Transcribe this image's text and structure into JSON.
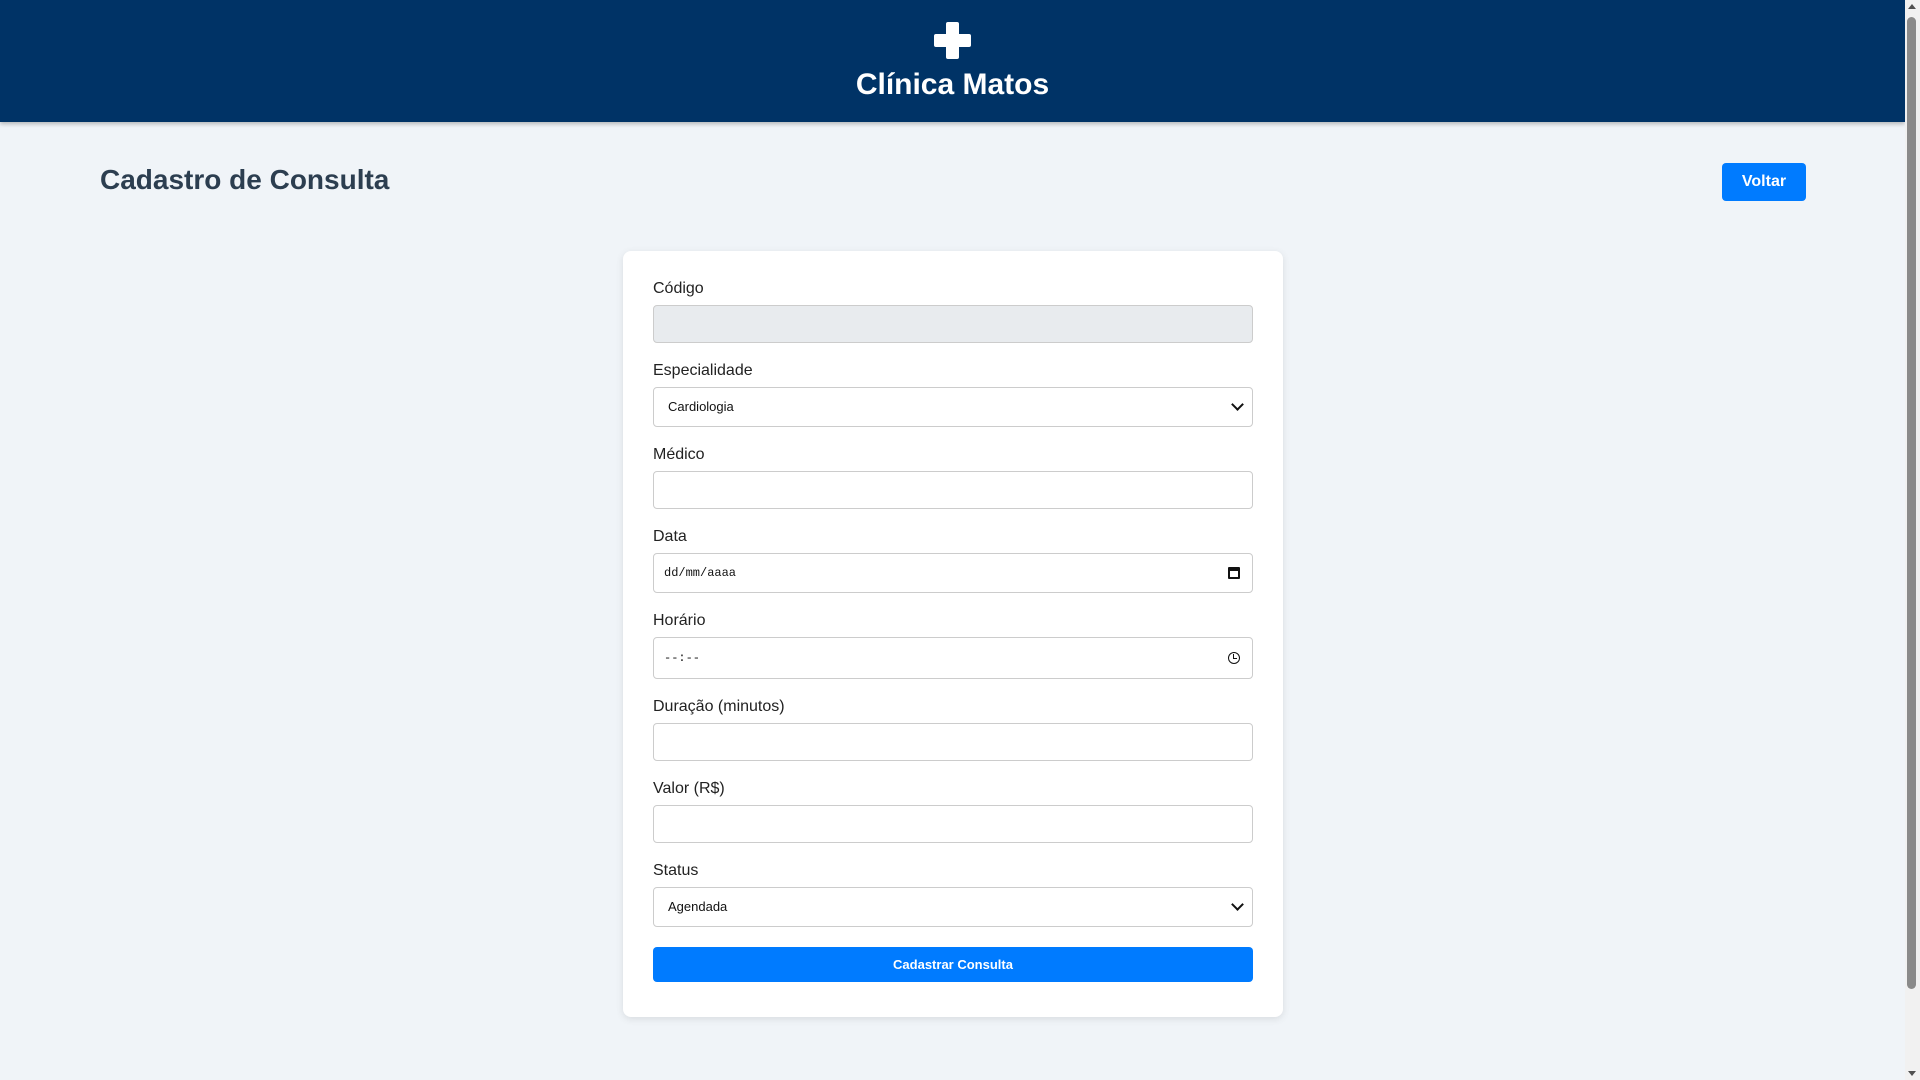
{
  "header": {
    "brand_icon": "medical-cross-icon",
    "brand_name": "Clínica Matos"
  },
  "main": {
    "title": "Cadastro de Consulta",
    "back_label": "Voltar"
  },
  "form": {
    "codigo": {
      "label": "Código",
      "value": ""
    },
    "especialidade": {
      "label": "Especialidade",
      "selected": "Cardiologia"
    },
    "medico": {
      "label": "Médico",
      "value": ""
    },
    "data": {
      "label": "Data",
      "placeholder": "dd/mm/aaaa",
      "icon": "calendar-icon"
    },
    "horario": {
      "label": "Horário",
      "placeholder": "--:--",
      "icon": "clock-icon"
    },
    "duracao": {
      "label": "Duração (minutos)",
      "value": ""
    },
    "valor": {
      "label": "Valor (R$)",
      "value": ""
    },
    "status": {
      "label": "Status",
      "selected": "Agendada"
    },
    "submit_label": "Cadastrar Consulta"
  },
  "colors": {
    "header_bg": "#003366",
    "page_bg": "#f0f4f8",
    "accent": "#007bff",
    "title_text": "#2c3e50"
  }
}
